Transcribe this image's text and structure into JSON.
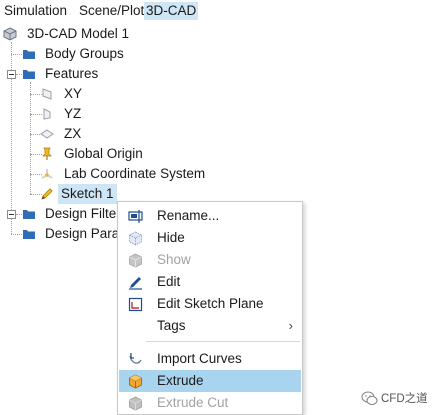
{
  "tabs": [
    {
      "label": "Simulation"
    },
    {
      "label": "Scene/Plot"
    },
    {
      "label": "3D-CAD",
      "active": true
    }
  ],
  "tree": {
    "root": "3D-CAD Model 1",
    "body_groups": "Body Groups",
    "features": "Features",
    "feature_items": [
      "XY",
      "YZ",
      "ZX",
      "Global Origin",
      "Lab Coordinate System",
      "Sketch 1"
    ],
    "design_filters": "Design Filte",
    "design_parameters": "Design Para"
  },
  "context_menu": {
    "items": [
      {
        "label": "Rename...",
        "icon": "rename-icon",
        "enabled": true
      },
      {
        "label": "Hide",
        "icon": "hide-cube-icon",
        "enabled": true
      },
      {
        "label": "Show",
        "icon": "show-icon",
        "enabled": false
      },
      {
        "label": "Edit",
        "icon": "edit-pencil-icon",
        "enabled": true
      },
      {
        "label": "Edit Sketch Plane",
        "icon": "sketch-plane-icon",
        "enabled": true
      },
      {
        "label": "Tags",
        "submenu": true,
        "enabled": true
      },
      {
        "label": "Import Curves",
        "icon": "import-curves-icon",
        "enabled": true
      },
      {
        "label": "Extrude",
        "icon": "extrude-icon",
        "enabled": true,
        "highlighted": true
      },
      {
        "label": "Extrude Cut",
        "icon": "extrude-cut-icon",
        "enabled": false
      }
    ],
    "submenu_arrow": "›"
  },
  "watermark": {
    "text": "CFD之道"
  },
  "colors": {
    "selection": "#cde5f5",
    "menu_hover": "#a9d4f0",
    "folder": "#2f6db5",
    "disabled_text": "#a2a2a2"
  }
}
